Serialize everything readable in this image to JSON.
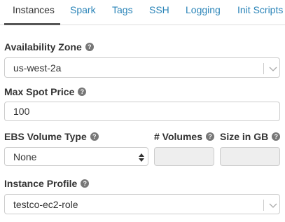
{
  "tabs": [
    {
      "label": "Instances",
      "active": true
    },
    {
      "label": "Spark",
      "active": false
    },
    {
      "label": "Tags",
      "active": false
    },
    {
      "label": "SSH",
      "active": false
    },
    {
      "label": "Logging",
      "active": false
    },
    {
      "label": "Init Scripts",
      "active": false
    }
  ],
  "availability_zone": {
    "label": "Availability Zone",
    "value": "us-west-2a"
  },
  "max_spot_price": {
    "label": "Max Spot Price",
    "value": "100"
  },
  "ebs_volume_type": {
    "label": "EBS Volume Type",
    "value": "None"
  },
  "num_volumes": {
    "label": "# Volumes",
    "value": ""
  },
  "size_in_gb": {
    "label": "Size in GB",
    "value": ""
  },
  "instance_profile": {
    "label": "Instance Profile",
    "value": "testco-ec2-role"
  },
  "help_glyph": "?",
  "colors": {
    "tab_link": "#2a84b8",
    "active_underline": "#555555",
    "border": "#cccccc",
    "disabled_bg": "#eeeeee"
  }
}
